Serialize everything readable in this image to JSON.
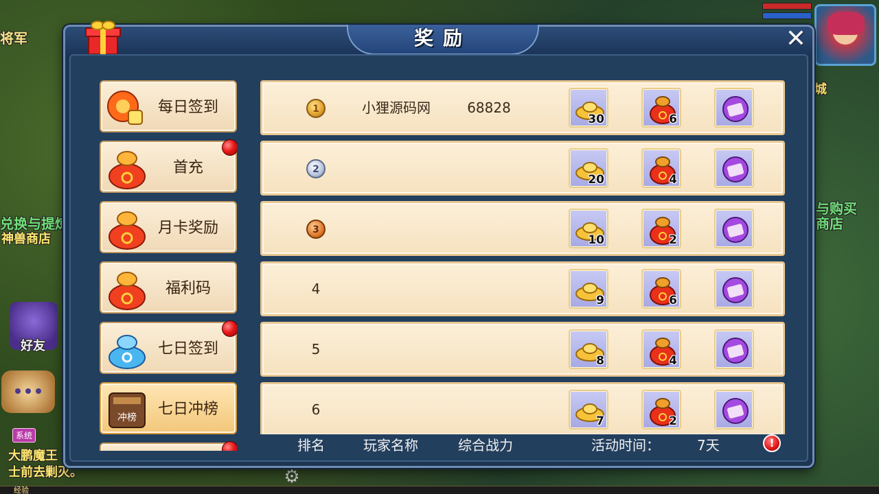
{
  "background": {
    "text_general": "将军",
    "text_exchange": "兑换与提炼",
    "text_beast_shop": "神兽商店",
    "text_friend": "好友",
    "text_system_badge": "系统",
    "text_chat_1": "大鹏魔王",
    "text_chat_2": "士前去剿灭。",
    "text_right_city": "城",
    "text_right_buy": "与购买",
    "text_right_shop": "商店",
    "text_exp": "经验"
  },
  "panel": {
    "title": "奖励",
    "close_label": "✕"
  },
  "menu": {
    "items": [
      {
        "label": "每日签到",
        "active": false,
        "red_dot": false,
        "icon": "daily-signin-icon"
      },
      {
        "label": "首充",
        "active": false,
        "red_dot": true,
        "icon": "money-bag-icon"
      },
      {
        "label": "月卡奖励",
        "active": false,
        "red_dot": false,
        "icon": "money-bag-icon"
      },
      {
        "label": "福利码",
        "active": false,
        "red_dot": false,
        "icon": "money-bag-icon"
      },
      {
        "label": "七日签到",
        "active": false,
        "red_dot": true,
        "icon": "blue-bag-icon"
      },
      {
        "label": "七日冲榜",
        "active": true,
        "red_dot": false,
        "icon": "ranking-board-icon",
        "icon_text": "冲榜"
      }
    ]
  },
  "rows": [
    {
      "rank": "1",
      "medal": "gold",
      "player": "小狸源码网",
      "power": "68828",
      "rewards": [
        "30",
        "6",
        ""
      ]
    },
    {
      "rank": "2",
      "medal": "silver",
      "player": "",
      "power": "",
      "rewards": [
        "20",
        "4",
        ""
      ]
    },
    {
      "rank": "3",
      "medal": "bronze",
      "player": "",
      "power": "",
      "rewards": [
        "10",
        "2",
        ""
      ]
    },
    {
      "rank": "4",
      "medal": "",
      "player": "",
      "power": "",
      "rewards": [
        "9",
        "6",
        ""
      ]
    },
    {
      "rank": "5",
      "medal": "",
      "player": "",
      "power": "",
      "rewards": [
        "8",
        "4",
        ""
      ]
    },
    {
      "rank": "6",
      "medal": "",
      "player": "",
      "power": "",
      "rewards": [
        "7",
        "2",
        ""
      ]
    }
  ],
  "footer": {
    "col_rank": "排名",
    "col_player": "玩家名称",
    "col_power": "综合战力",
    "time_label": "活动时间：",
    "time_value": "7天",
    "info_symbol": "!"
  },
  "colors": {
    "panel_bg": "#1d3550",
    "row_bg": "#fcefd8",
    "slot_bg": "#c7c9f4",
    "red_dot": "#e81818"
  }
}
